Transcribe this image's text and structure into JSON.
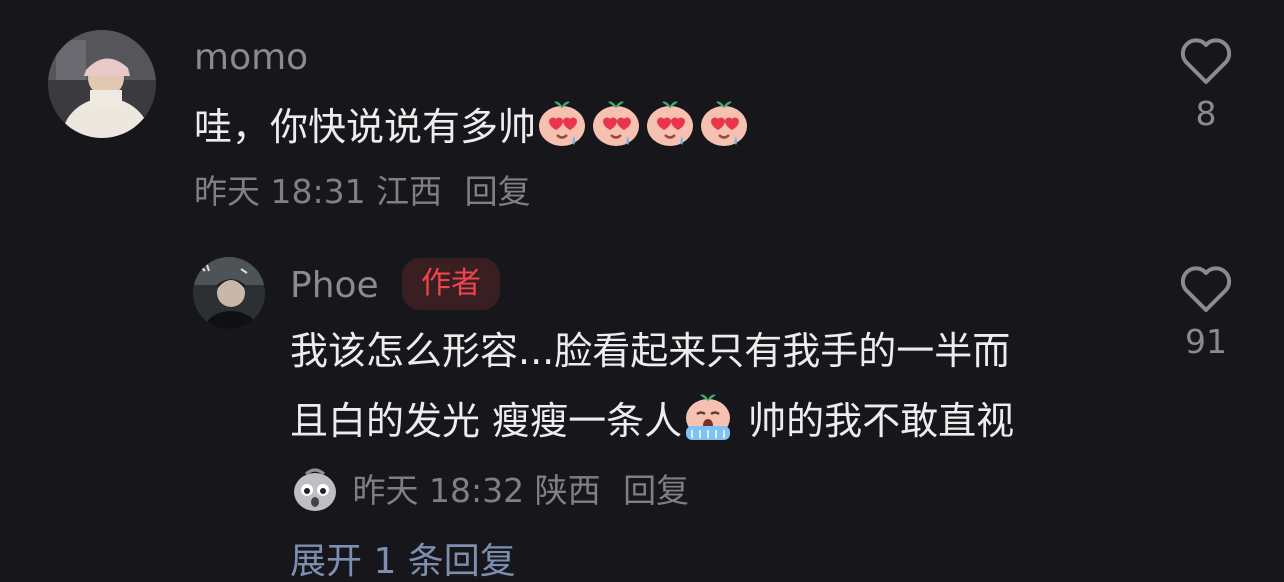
{
  "comment": {
    "username": "momo",
    "text_main": "哇，你快说说有多帅",
    "emojis": [
      "heart-eyes-emoji",
      "heart-eyes-emoji",
      "heart-eyes-emoji",
      "heart-eyes-emoji"
    ],
    "time": "昨天 18:31",
    "location": "江西",
    "reply_label": "回复",
    "like_count": "8"
  },
  "reply": {
    "username": "Phoe",
    "badge": "作者",
    "line1": "我该怎么形容...脸看起来只有我手的一半而",
    "line2_a": "且白的发光 瘦瘦一条人",
    "line2_emoji": "crying-emoji",
    "line2_b": " 帅的我不敢直视",
    "sticker": "shocked-emoji",
    "time": "昨天 18:32",
    "location": "陕西",
    "reply_label": "回复",
    "like_count": "91"
  },
  "expand_label": "展开 1 条回复",
  "colors": {
    "background": "#17161b",
    "badge_text": "#f0444f",
    "badge_bg": "#3a1f22",
    "link": "#7c8fb0"
  }
}
